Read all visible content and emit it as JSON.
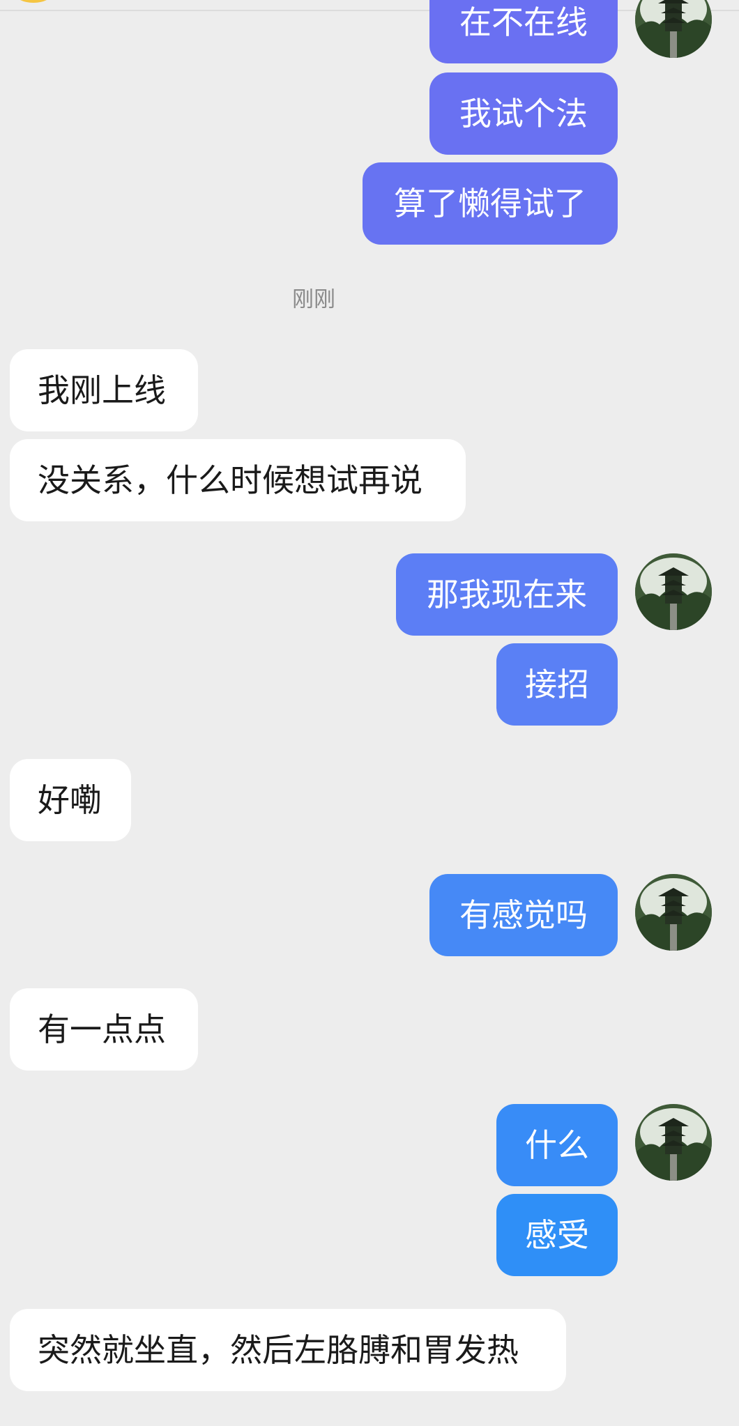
{
  "colors": {
    "background": "#ededed",
    "incoming_bubble": "#ffffff",
    "outgoing_bubble_gradient": [
      "#6a72f2",
      "#5d7ef5",
      "#4a8bf5",
      "#2f8ff7"
    ]
  },
  "timestamp": "刚刚",
  "messages": [
    {
      "direction": "outgoing",
      "text": "在不在线",
      "avatar": true
    },
    {
      "direction": "outgoing",
      "text": "我试个法",
      "avatar": false
    },
    {
      "direction": "outgoing",
      "text": "算了懒得试了",
      "avatar": false
    },
    {
      "direction": "incoming",
      "text": "我刚上线"
    },
    {
      "direction": "incoming",
      "text": "没关系，什么时候想试再说"
    },
    {
      "direction": "outgoing",
      "text": "那我现在来",
      "avatar": true
    },
    {
      "direction": "outgoing",
      "text": "接招",
      "avatar": false
    },
    {
      "direction": "incoming",
      "text": "好嘞"
    },
    {
      "direction": "outgoing",
      "text": "有感觉吗",
      "avatar": true
    },
    {
      "direction": "incoming",
      "text": "有一点点"
    },
    {
      "direction": "outgoing",
      "text": "什么",
      "avatar": true
    },
    {
      "direction": "outgoing",
      "text": "感受",
      "avatar": false
    },
    {
      "direction": "incoming",
      "text": "突然就坐直，然后左胳膊和胃发热"
    }
  ],
  "avatar_icon": "pagoda-avatar-icon"
}
